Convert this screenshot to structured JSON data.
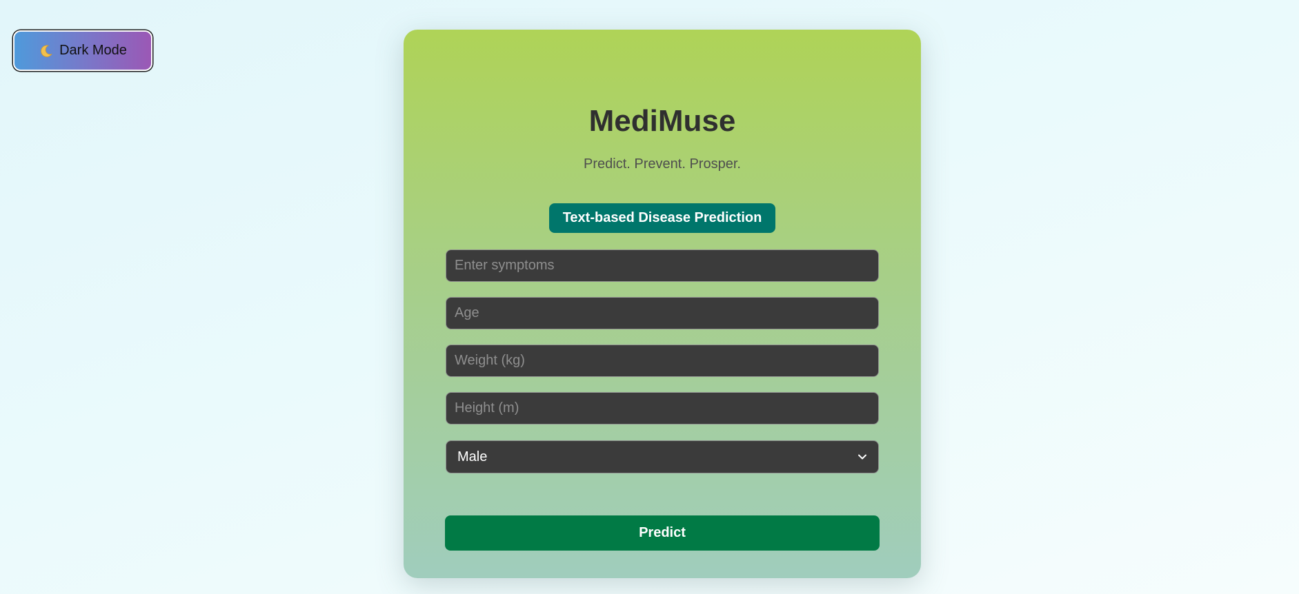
{
  "theme_toggle": {
    "icon": "moon-icon",
    "label": "Dark Mode"
  },
  "app": {
    "title": "MediMuse",
    "tagline": "Predict. Prevent. Prosper."
  },
  "form": {
    "section_title": "Text-based Disease Prediction",
    "symptoms_placeholder": "Enter symptoms",
    "age_placeholder": "Age",
    "weight_placeholder": "Weight (kg)",
    "height_placeholder": "Height (m)",
    "gender_selected": "Male",
    "submit_label": "Predict"
  },
  "colors": {
    "card_gradient_top": "#afd357",
    "card_gradient_bottom": "#a0cdbd",
    "badge": "#00766b",
    "predict_button": "#017a45",
    "input_background": "#3b3b3b"
  }
}
